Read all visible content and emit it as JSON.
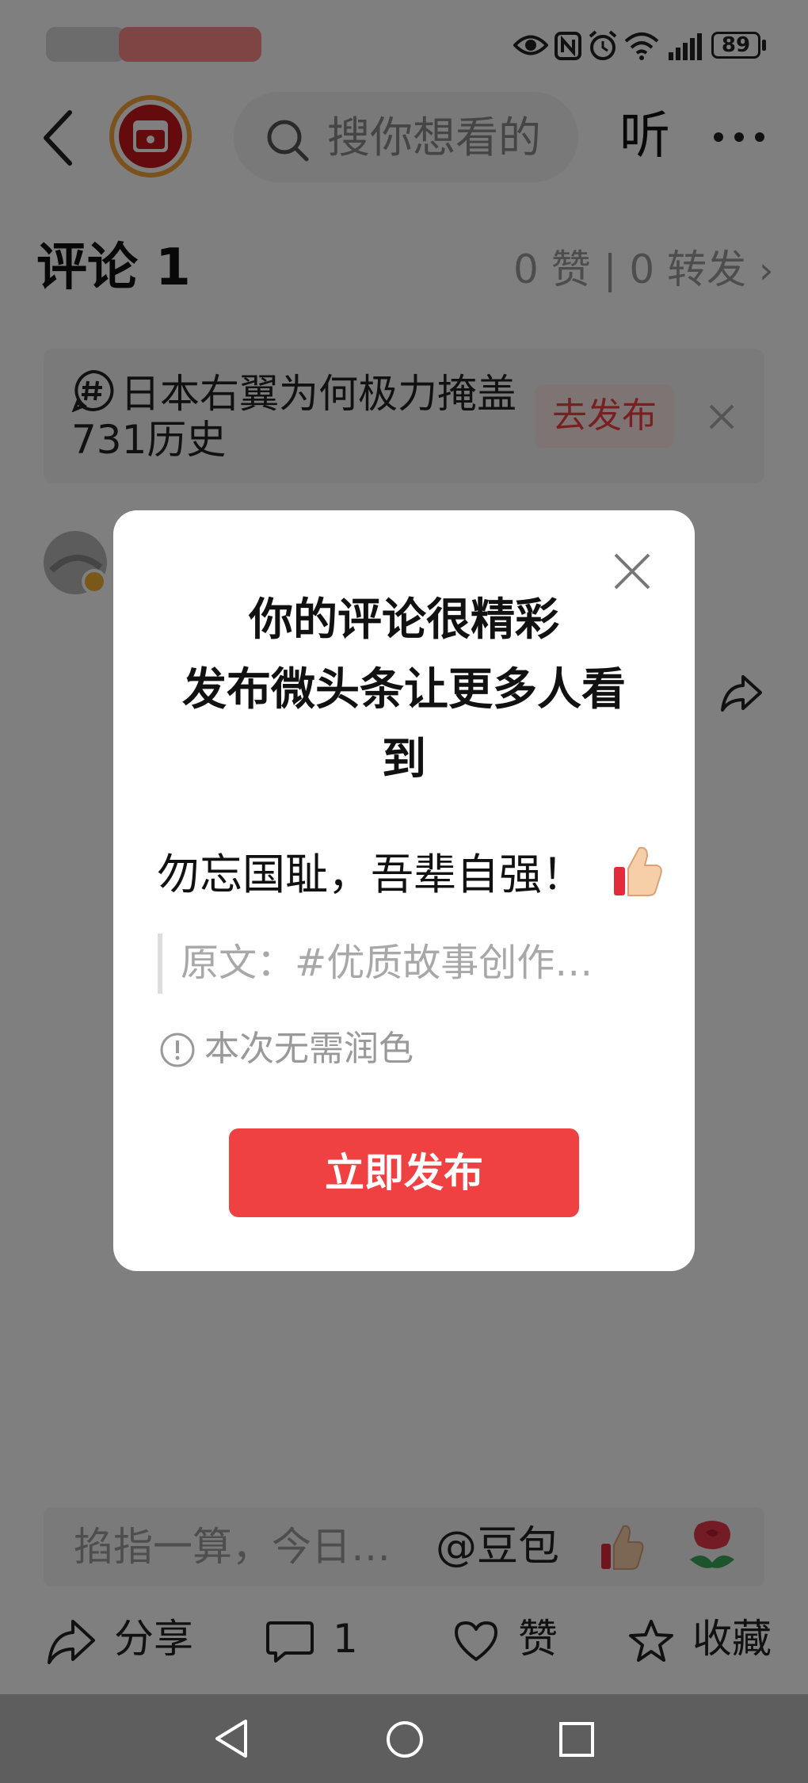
{
  "status_bar": {
    "battery_level": "89"
  },
  "header": {
    "search_placeholder": "搜你想看的",
    "listen_label": "听"
  },
  "comments": {
    "title": "评论 1",
    "stats": "0 赞 | 0 转发"
  },
  "topic_card": {
    "text": "日本右翼为何极力掩盖731历史",
    "button_label": "去发布"
  },
  "modal": {
    "title_line1": "你的评论很精彩",
    "title_line2": "发布微头条让更多人看",
    "title_line3": "到",
    "comment_text": "勿忘国耻，吾辈自强！",
    "original_text": "原文：#优质故事创作…",
    "hint": "本次无需润色",
    "publish_button": "立即发布"
  },
  "input_bar": {
    "placeholder": "掐指一算，今日…",
    "mention": "@豆包"
  },
  "actions": {
    "share": "分享",
    "comment_count": "1",
    "like": "赞",
    "favorite": "收藏"
  }
}
